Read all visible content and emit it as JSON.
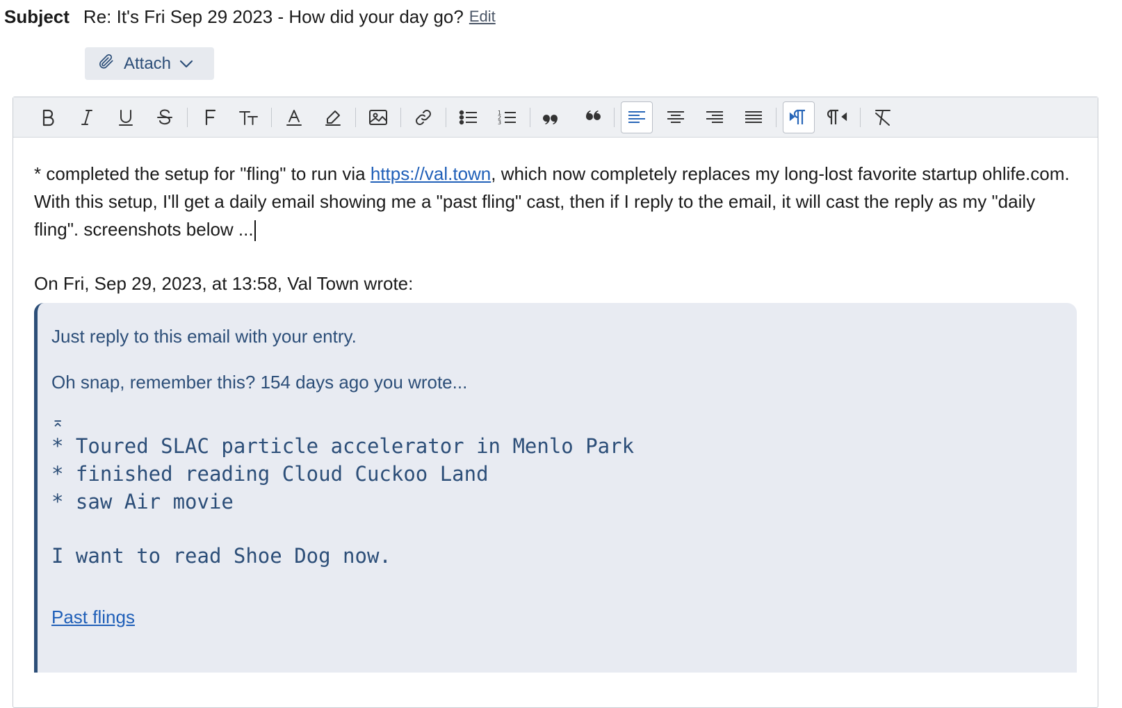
{
  "subject": {
    "label": "Subject",
    "text": "Re: It's Fri Sep 29 2023 - How did your day go?",
    "edit": "Edit"
  },
  "attach": {
    "label": "Attach",
    "icons": [
      "paperclip-icon",
      "chevron-down-icon"
    ]
  },
  "toolbar": {
    "buttons": [
      "bold",
      "italic",
      "underline",
      "strikethrough",
      "font",
      "text-size",
      "text-color",
      "highlight",
      "image",
      "link",
      "bullet-list",
      "numbered-list",
      "quote",
      "unquote",
      "align-left",
      "align-center",
      "align-right",
      "justify",
      "ltr",
      "rtl",
      "clear-formatting"
    ],
    "active": [
      "align-left",
      "ltr"
    ],
    "accent": "#2866b8"
  },
  "body": {
    "line1_pre": "* completed the setup for \"fling\" to run via ",
    "link": "https://val.town",
    "line1_post": ", which now completely replaces my long-lost favorite startup ohlife.com. With this setup, I'll get a daily email showing me a \"past fling\" cast, then if I reply to the email, it will cast the reply as my \"daily fling\". screenshots below ...",
    "wrote": "On Fri, Sep 29, 2023, at 13:58, Val Town wrote:"
  },
  "quote": {
    "line1": "Just reply to this email with your entry.",
    "line2": "Oh snap, remember this? 154 days ago you wrote...",
    "mark": "⌅",
    "items": [
      "* Toured SLAC particle accelerator in Menlo Park",
      "* finished reading Cloud Cuckoo Land",
      "* saw Air movie"
    ],
    "closing": "I want to read Shoe Dog now.",
    "link": "Past flings",
    "color": "#2c4e78",
    "background": "#e8ebf2"
  }
}
